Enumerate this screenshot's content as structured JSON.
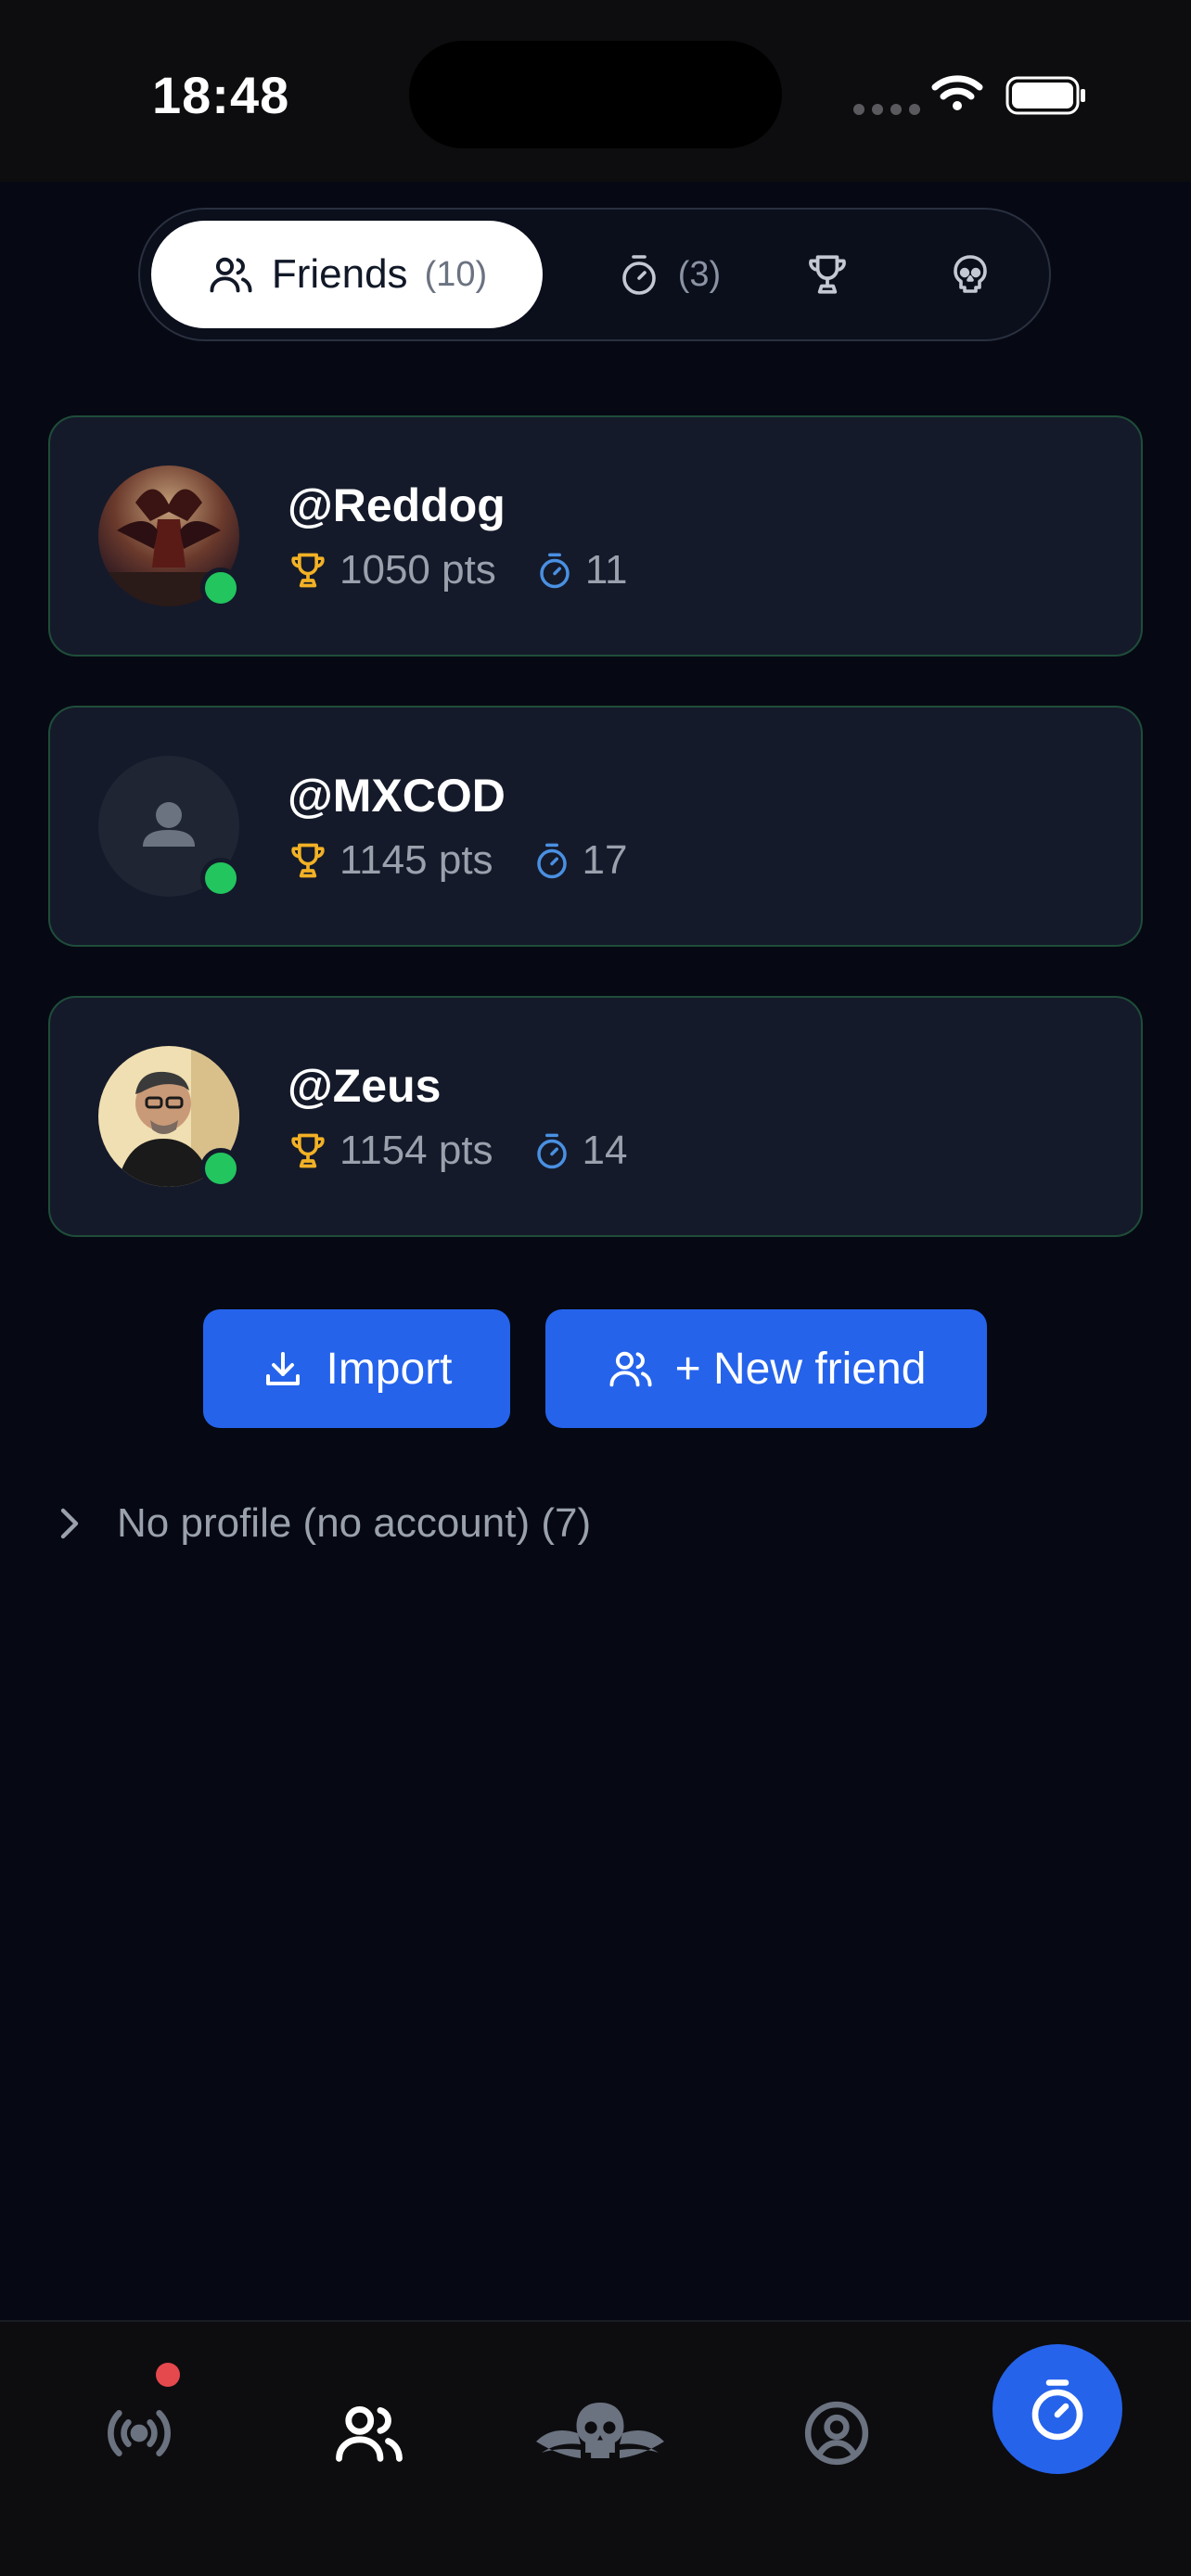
{
  "status_bar": {
    "time": "18:48"
  },
  "segments": {
    "friends_label": "Friends",
    "friends_count": "(10)",
    "timer_count": "(3)"
  },
  "friends": [
    {
      "username": "@Reddog",
      "points": "1050 pts",
      "timer": "11",
      "online": true
    },
    {
      "username": "@MXCOD",
      "points": "1145 pts",
      "timer": "17",
      "online": true
    },
    {
      "username": "@Zeus",
      "points": "1154 pts",
      "timer": "14",
      "online": true
    }
  ],
  "actions": {
    "import_label": "Import",
    "new_friend_label": "+ New friend"
  },
  "no_profile": {
    "label": "No profile (no account) (7)"
  },
  "colors": {
    "background": "#060913",
    "card": "#141a2a",
    "card_border": "#1f4d3a",
    "accent": "#2563eb",
    "online": "#22c55e",
    "trophy": "#f2b125",
    "timer": "#4a90e2"
  },
  "tabbar": {
    "items": [
      "broadcast-icon",
      "friends-icon",
      "skull-wings-icon",
      "profile-icon",
      "stopwatch-icon"
    ]
  }
}
